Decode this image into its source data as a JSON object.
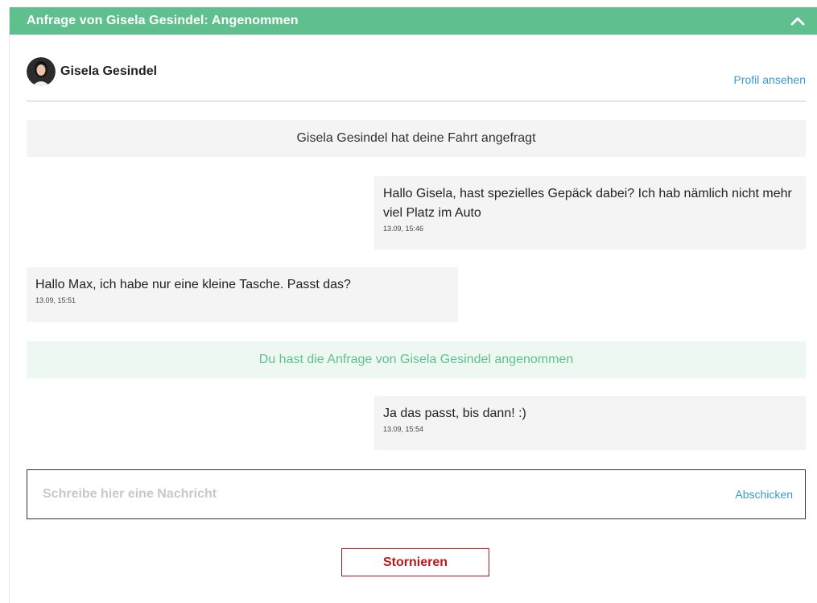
{
  "header": {
    "title": "Anfrage von Gisela Gesindel: Angenommen",
    "collapse_icon": "chevron-up-icon"
  },
  "profile": {
    "name": "Gisela Gesindel",
    "link_label": "Profil ansehen",
    "avatar_icon": "avatar-photo"
  },
  "messages": {
    "system_request": "Gisela Gesindel hat deine Fahrt angefragt",
    "msg1": {
      "text": "Hallo Gisela, hast spezielles Gepäck dabei? Ich hab nämlich nicht mehr viel Platz im Auto",
      "time": "13.09, 15:46"
    },
    "msg2": {
      "text": "Hallo Max, ich habe nur eine kleine Tasche. Passt das?",
      "time": "13.09, 15:51"
    },
    "system_accepted": "Du hast die Anfrage von Gisela Gesindel angenommen",
    "msg3": {
      "text": "Ja das passt, bis dann! :)",
      "time": "13.09, 15:54"
    }
  },
  "composer": {
    "placeholder": "Schreibe hier eine Nachricht",
    "value": "",
    "send_label": "Abschicken"
  },
  "actions": {
    "cancel_label": "Stornieren"
  },
  "colors": {
    "accent_green": "#5fc08e",
    "link_blue": "#3a9bd1",
    "danger_red": "#c0161b"
  }
}
